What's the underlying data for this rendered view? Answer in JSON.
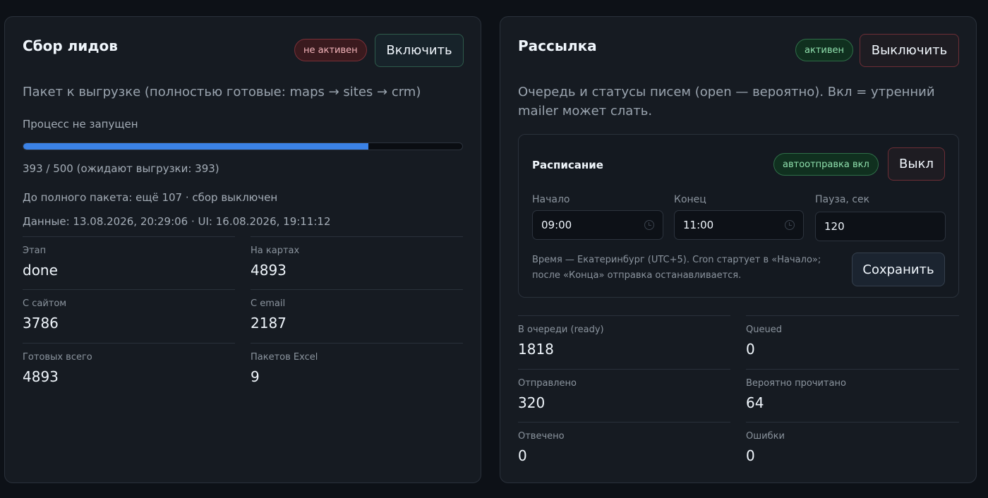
{
  "leads": {
    "title": "Сбор лидов",
    "status_badge": "не активен",
    "toggle_label": "Включить",
    "description": "Пакет к выгрузке (полностью готовые: maps → sites → crm)",
    "process_status": "Процесс не запущен",
    "progress": {
      "current": 393,
      "total": 500,
      "fraction": 0.786
    },
    "progress_text": "393 / 500 (ожидают выгрузки: 393)",
    "remaining_text": "До полного пакета: ещё 107 · сбор выключен",
    "data_timestamp": "Данные: 13.08.2026, 20:29:06 · UI: 16.08.2026, 19:11:12",
    "stats": [
      {
        "label": "Этап",
        "value": "done"
      },
      {
        "label": "На картах",
        "value": "4893"
      },
      {
        "label": "С сайтом",
        "value": "3786"
      },
      {
        "label": "С email",
        "value": "2187"
      },
      {
        "label": "Готовых всего",
        "value": "4893"
      },
      {
        "label": "Пакетов Excel",
        "value": "9"
      }
    ]
  },
  "mailing": {
    "title": "Рассылка",
    "status_badge": "активен",
    "toggle_label": "Выключить",
    "description": "Очередь и статусы писем (open — вероятно). Вкл = утренний mailer может слать.",
    "schedule": {
      "title": "Расписание",
      "auto_badge": "автоотправка вкл",
      "off_label": "Выкл",
      "start_label": "Начало",
      "start_value": "09:00",
      "end_label": "Конец",
      "end_value": "11:00",
      "pause_label": "Пауза, сек",
      "pause_value": "120",
      "note_line1": "Время — Екатеринбург (UTC+5). Cron стартует в «Начало»;",
      "note_line2": "после «Конца» отправка останавливается.",
      "save_label": "Сохранить"
    },
    "stats": [
      {
        "label": "В очереди (ready)",
        "value": "1818"
      },
      {
        "label": "Queued",
        "value": "0"
      },
      {
        "label": "Отправлено",
        "value": "320"
      },
      {
        "label": "Вероятно прочитано",
        "value": "64"
      },
      {
        "label": "Отвечено",
        "value": "0"
      },
      {
        "label": "Ошибки",
        "value": "0"
      }
    ]
  },
  "colors": {
    "accent": "#3b82e6",
    "badge_off": "#f3b4ba",
    "badge_on": "#8fe0ad"
  }
}
